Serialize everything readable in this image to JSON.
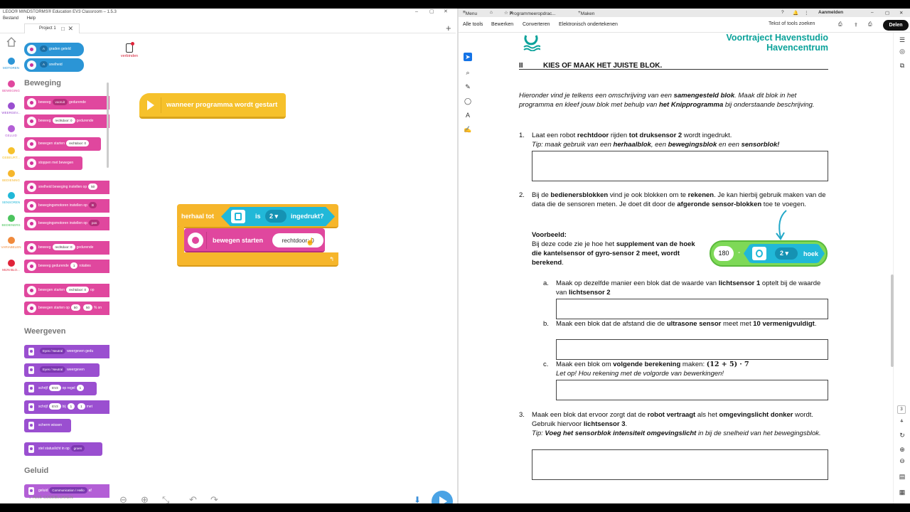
{
  "ev3": {
    "titlebar": "LEGO® MINDSTORMS® Education EV3 Classroom – 1.5.3",
    "menu": {
      "file": "Bestand",
      "help": "Help"
    },
    "tab_name": "Project 1",
    "connect_label": "verbinden",
    "categories": [
      {
        "label": "MOTOREN",
        "color": "#2b95d6"
      },
      {
        "label": "BEWEGING",
        "color": "#e0479e"
      },
      {
        "label": "WEERGEV...",
        "color": "#9a4fd0"
      },
      {
        "label": "GELUID",
        "color": "#b35fd6"
      },
      {
        "label": "GEBEURT...",
        "color": "#f6c12b"
      },
      {
        "label": "BEDIENING",
        "color": "#f6b62b"
      },
      {
        "label": "SENSOREN",
        "color": "#21b8d8"
      },
      {
        "label": "BEDIENERS",
        "color": "#4cc45e"
      },
      {
        "label": "VARIABELEN",
        "color": "#f08a3c"
      },
      {
        "label": "MIJN BLO...",
        "color": "#e0243a"
      }
    ],
    "palette": {
      "top_blocks": [
        {
          "port": "A",
          "text": "graden geteld"
        },
        {
          "port": "A",
          "text": "snelheid"
        }
      ],
      "beweging_head": "Beweging",
      "beweging": [
        {
          "pre": "beweeg",
          "p1": "vooruit",
          "post": "gedurende"
        },
        {
          "pre": "beweeg",
          "p1": "rechtdoor: 0",
          "post": "gedurende"
        },
        {
          "pre": "bewegen starten",
          "p1": "rechtdoor: 0",
          "post": ""
        },
        {
          "pre": "stoppen met bewegen",
          "p1": "",
          "post": ""
        },
        {
          "pre": "snelheid beweging instellen op",
          "p1": "50",
          "post": ""
        },
        {
          "pre": "bewegingsmotoren instellen op",
          "p1": "B",
          "post": ""
        },
        {
          "pre": "bewegingsmotoren instellen op",
          "p1": "pos",
          "post": ""
        },
        {
          "pre": "beweeg",
          "p1": "rechtdoor: 0",
          "post": "gedurende"
        },
        {
          "pre": "beweeg gedurende",
          "p1": "1",
          "post": "rotaties"
        },
        {
          "pre": "bewegen starten",
          "p1": "rechtdoor: 0",
          "post": "op"
        },
        {
          "pre": "bewegen starten op",
          "p1": "50",
          "p2": "50",
          "post": "% sn"
        }
      ],
      "weergeven_head": "Weergeven",
      "weergeven": [
        {
          "pre": "",
          "p1": "Eyes / Neutral",
          "post": "weergeven gedu"
        },
        {
          "pre": "",
          "p1": "Eyes / Neutral",
          "post": "weergeven"
        },
        {
          "pre": "schrijf",
          "p1": "EV3",
          "post": "op regel",
          "p2": "1"
        },
        {
          "pre": "schrijf",
          "p1": "EV3",
          "post": "bij",
          "p2": "1",
          "p3": "1",
          "post2": "met"
        },
        {
          "pre": "scherm wissen",
          "p1": "",
          "post": ""
        },
        {
          "pre": "stel statuslicht in op",
          "p1": "groen",
          "post": ""
        }
      ],
      "geluid_head": "Geluid",
      "geluid": [
        {
          "pre": "geluid",
          "p1": "Communication / Hello",
          "post": "af"
        }
      ],
      "all_blocks": "ALLE CODEBLOKKEN"
    },
    "workspace": {
      "hat_label": "wanneer programma wordt gestart",
      "loop_label": "herhaal tot",
      "sensor_is": "is",
      "sensor_port": "2",
      "sensor_state": "ingedrukt?",
      "motor_label": "bewegen starten",
      "motor_value": "rechtdoor: 0"
    }
  },
  "pdf": {
    "tabs": {
      "menu": "Menu",
      "doc": "Programmeeropdrac...",
      "new": "Maken",
      "login": "Aanmelden"
    },
    "toolbar": {
      "all_tools": "Alle tools",
      "edit": "Bewerken",
      "convert": "Converteren",
      "sign": "Elektronisch ondertekenen",
      "search": "Tekst of tools zoeken",
      "share": "Delen"
    },
    "pages": [
      "3",
      "4"
    ],
    "header": {
      "line1": "Voortraject Havenstudio",
      "line2": "Havencentrum"
    },
    "section": {
      "num": "II",
      "title": "KIES OF MAAK HET JUISTE BLOK."
    },
    "intro": {
      "a": "Hieronder vind je telkens een omschrijving van een ",
      "b": "samengesteld blok",
      "c": ". Maak dit blok in het programma en kleef jouw blok met behulp van ",
      "d": "het Knipprogramma",
      "e": " bij onderstaande beschrijving."
    },
    "q1": {
      "num": "1.",
      "a": "Laat een robot ",
      "b": "rechtdoor",
      "c": " rijden ",
      "d": "tot druksensor 2",
      "e": " wordt ingedrukt.",
      "tip_a": "Tip: maak gebruik van een ",
      "tip_b": "herhaalblok",
      "tip_c": ", een ",
      "tip_d": "bewegingsblok",
      "tip_e": " en een ",
      "tip_f": "sensorblok!"
    },
    "q2": {
      "num": "2.",
      "a": "Bij de ",
      "b": "bedienersblokken",
      "c": " vind je ook blokken om te ",
      "d": "rekenen",
      "e": ". Je kan hierbij gebruik maken van de data die de sensoren meten. Je doet dit door de ",
      "f": "afgeronde sensor-blokken",
      "g": " toe te voegen.",
      "ex_title": "Voorbeeld:",
      "ex_a": "Bij deze code zie je hoe het ",
      "ex_b": "supplement van de hoek die kantelsensor of gyro-sensor 2 meet, wordt berekend",
      "ex_c": ".",
      "block": {
        "value": "180",
        "op": "-",
        "port": "2",
        "label": "hoek"
      },
      "subs": [
        {
          "n": "a.",
          "a": "Maak op dezelfde manier een blok dat de waarde van ",
          "b": "lichtsensor 1",
          "c": " optelt bij de waarde van ",
          "d": "lichtsensor 2"
        },
        {
          "n": "b.",
          "a": "Maak een blok dat de afstand die de ",
          "b": "ultrasone sensor",
          "c": " meet met ",
          "d": "10 vermenigvuldigt",
          "e": "."
        },
        {
          "n": "c.",
          "a": "Maak een blok om ",
          "b": "volgende berekening",
          "c": " maken: ",
          "d": "(12 + 5) · 7",
          "tip": "Let op! Hou rekening met de volgorde van bewerkingen!"
        }
      ]
    },
    "q3": {
      "num": "3.",
      "a": "Maak een blok dat ervoor zorgt dat de ",
      "b": "robot vertraagt",
      "c": " als het ",
      "d": "omgevingslicht donker",
      "e": " wordt. Gebruik hiervoor ",
      "f": "lichtsensor 3",
      "g": ".",
      "tip_a": "Tip: ",
      "tip_b": "Voeg het sensorblok intensiteit omgevingslicht",
      "tip_c": " in bij de snelheid van het bewegingsblok."
    }
  }
}
